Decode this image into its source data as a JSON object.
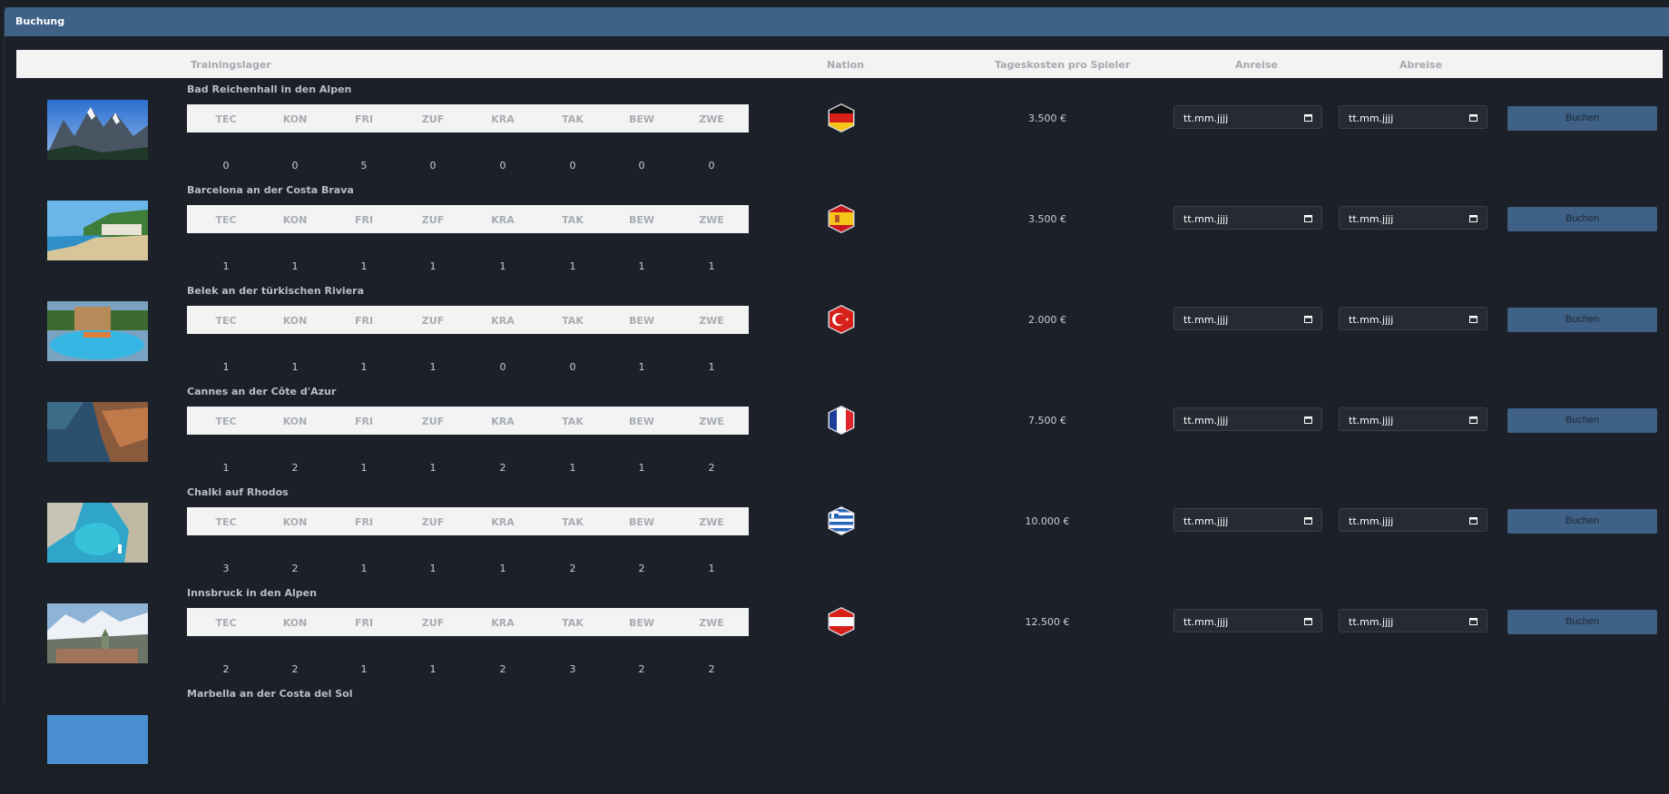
{
  "panel": {
    "title": "Buchung"
  },
  "columns": {
    "camp": "Trainingslager",
    "nation": "Nation",
    "cost": "Tageskosten pro Spieler",
    "arrival": "Anreise",
    "departure": "Abreise"
  },
  "stat_labels": [
    "TEC",
    "KON",
    "FRI",
    "ZUF",
    "KRA",
    "TAK",
    "BEW",
    "ZWE"
  ],
  "date_placeholder": "tt.mm.jjjj",
  "book_label": "Buchen",
  "camps": [
    {
      "name": "Bad Reichenhall in den Alpen",
      "nation_icon": "germany-flag-icon",
      "cost": "3.500 €",
      "stats": [
        "0",
        "0",
        "5",
        "0",
        "0",
        "0",
        "0",
        "0"
      ]
    },
    {
      "name": "Barcelona an der Costa Brava",
      "nation_icon": "spain-flag-icon",
      "cost": "3.500 €",
      "stats": [
        "1",
        "1",
        "1",
        "1",
        "1",
        "1",
        "1",
        "1"
      ]
    },
    {
      "name": "Belek an der türkischen Riviera",
      "nation_icon": "turkey-flag-icon",
      "cost": "2.000 €",
      "stats": [
        "1",
        "1",
        "1",
        "1",
        "0",
        "0",
        "1",
        "1"
      ]
    },
    {
      "name": "Cannes an der Côte d'Azur",
      "nation_icon": "france-flag-icon",
      "cost": "7.500 €",
      "stats": [
        "1",
        "2",
        "1",
        "1",
        "2",
        "1",
        "1",
        "2"
      ]
    },
    {
      "name": "Chalki auf Rhodos",
      "nation_icon": "greece-flag-icon",
      "cost": "10.000 €",
      "stats": [
        "3",
        "2",
        "1",
        "1",
        "1",
        "2",
        "2",
        "1"
      ]
    },
    {
      "name": "Innsbruck in den Alpen",
      "nation_icon": "austria-flag-icon",
      "cost": "12.500 €",
      "stats": [
        "2",
        "2",
        "1",
        "1",
        "2",
        "3",
        "2",
        "2"
      ]
    },
    {
      "name": "Marbella an der Costa del Sol",
      "nation_icon": "spain-flag-icon",
      "cost": "",
      "stats": []
    }
  ],
  "colors": {
    "header_bg": "#3f6186",
    "page_bg": "#1c2028",
    "table_header_bg": "#f3f3f3",
    "button_bg": "#3f6186"
  }
}
